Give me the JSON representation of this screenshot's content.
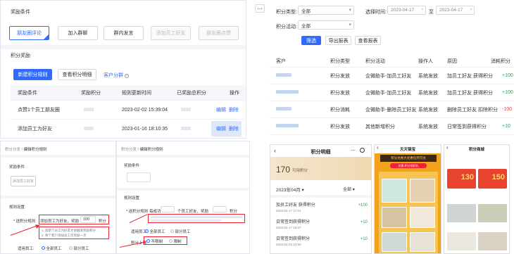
{
  "left_top": {
    "section_label": "奖励条件",
    "tabs": [
      {
        "label": "朋友圈评论",
        "state": "selected"
      },
      {
        "label": "加入群聊",
        "state": "normal"
      },
      {
        "label": "群内发言",
        "state": "normal"
      },
      {
        "label": "添加员工好友",
        "state": "disabled"
      },
      {
        "label": "朋友圈点赞",
        "state": "disabled"
      }
    ],
    "points_section": "积分奖励",
    "new_rule_button": "新建积分规则",
    "view_detail_button": "查看积分明细",
    "customer_group_link": "客户分群",
    "table": {
      "headers": [
        "奖励条件",
        "奖励积分",
        "规则更新时间",
        "已奖励总积分",
        "操作"
      ],
      "rows": [
        {
          "condition": "点赞1个员工朋友圈",
          "updated": "2023-02-02 15:39:04",
          "edit": "编辑",
          "delete": "删除"
        },
        {
          "condition": "添加员工为好友",
          "updated": "2023-01-16 18:10:35",
          "edit": "编辑",
          "delete": "删除"
        }
      ]
    }
  },
  "right_top": {
    "filter_type_label": "积分类型:",
    "filter_type_value": "全部",
    "select_time_label": "选择时间:",
    "date_start": "2023-04-17",
    "date_sep": "至",
    "date_end": "2023-04-17",
    "activity_label": "积分活动:",
    "activity_value": "全部",
    "btn_filter": "筛选",
    "btn_export": "导出报表",
    "btn_view_report": "查看报表",
    "headers": [
      "客户",
      "积分类型",
      "积分活动",
      "操作人",
      "原因",
      "消耗积分"
    ],
    "rows": [
      {
        "type": "积分发放",
        "activity": "企微助手-加员工好友",
        "operator": "系统发放",
        "reason": "加员工好友 获得积分",
        "value": "+100",
        "color": "#2ba24c"
      },
      {
        "type": "积分发放",
        "activity": "企微助手-加员工好友",
        "operator": "系统发放",
        "reason": "加员工好友 获得积分",
        "value": "+100",
        "color": "#2ba24c"
      },
      {
        "type": "积分消耗",
        "activity": "企微助手-删除员工好友",
        "operator": "系统发放",
        "reason": "删除员工好友 扣除积分",
        "value": "-100",
        "color": "#e5483b"
      },
      {
        "type": "积分发放",
        "activity": "其他新增积分",
        "operator": "系统发放",
        "reason": "日常签到获得积分",
        "value": "+10",
        "color": "#2ba24c"
      }
    ]
  },
  "left_bottom_a": {
    "breadcrumb_root": "积分分发",
    "breadcrumb_current": "编辑积分规则",
    "section_label": "奖励条件",
    "chip": "添加员工好友",
    "rule_label": "规则设置",
    "points_label": "* 送积分规则",
    "rule_text_1": "添加员工为好友，奖励",
    "rule_value": "100",
    "rule_unit": "积分",
    "note_1": "1. 加新个员工为好友才会触发奖励积分",
    "note_2": "2. 每个客户添加员工仅奖励一次",
    "scope_label": "适用员工:",
    "scope_all": "全部员工",
    "scope_part": "部分员工"
  },
  "left_bottom_b": {
    "breadcrumb_root": "积分分发",
    "breadcrumb_current": "编辑积分规则",
    "section_label": "奖励条件",
    "rule_label": "规则设置",
    "points_label": "* 送积分规则",
    "rule_text_1": "每成功",
    "rule_text_2": "个员工好友，奖励",
    "rule_unit": "积分",
    "scope_label": "适用员工:",
    "scope_all": "全部员工",
    "scope_part": "部分员工",
    "limit_label": "积分上限:",
    "limit_no": "不限制",
    "limit_yes": "限制"
  },
  "phone1": {
    "title": "积分明细",
    "points": "170",
    "points_label": "可用积分",
    "month": "2023年04月",
    "filter": "全部",
    "items": [
      {
        "name": "加员工好友 获得积分",
        "date": "2023-04-17 17:01",
        "value": "+100"
      },
      {
        "name": "日常签到获得积分",
        "date": "2023-04-17 15:57",
        "value": "+10"
      },
      {
        "name": "日常签到获得积分",
        "date": "2023-04-03 10:50",
        "value": "+10"
      }
    ]
  },
  "phone2": {
    "title": "天天锦宝",
    "banner": "积分兑换大优惠任然可兑",
    "sub_banner": "兑换·积分领好礼"
  },
  "phone3": {
    "title": "积分商城",
    "coupon_1": "130",
    "coupon_2": "150"
  },
  "colors": {
    "accent": "#2f6bff",
    "positive": "#2ba24c",
    "negative": "#e5483b",
    "highlight": "#e23"
  }
}
